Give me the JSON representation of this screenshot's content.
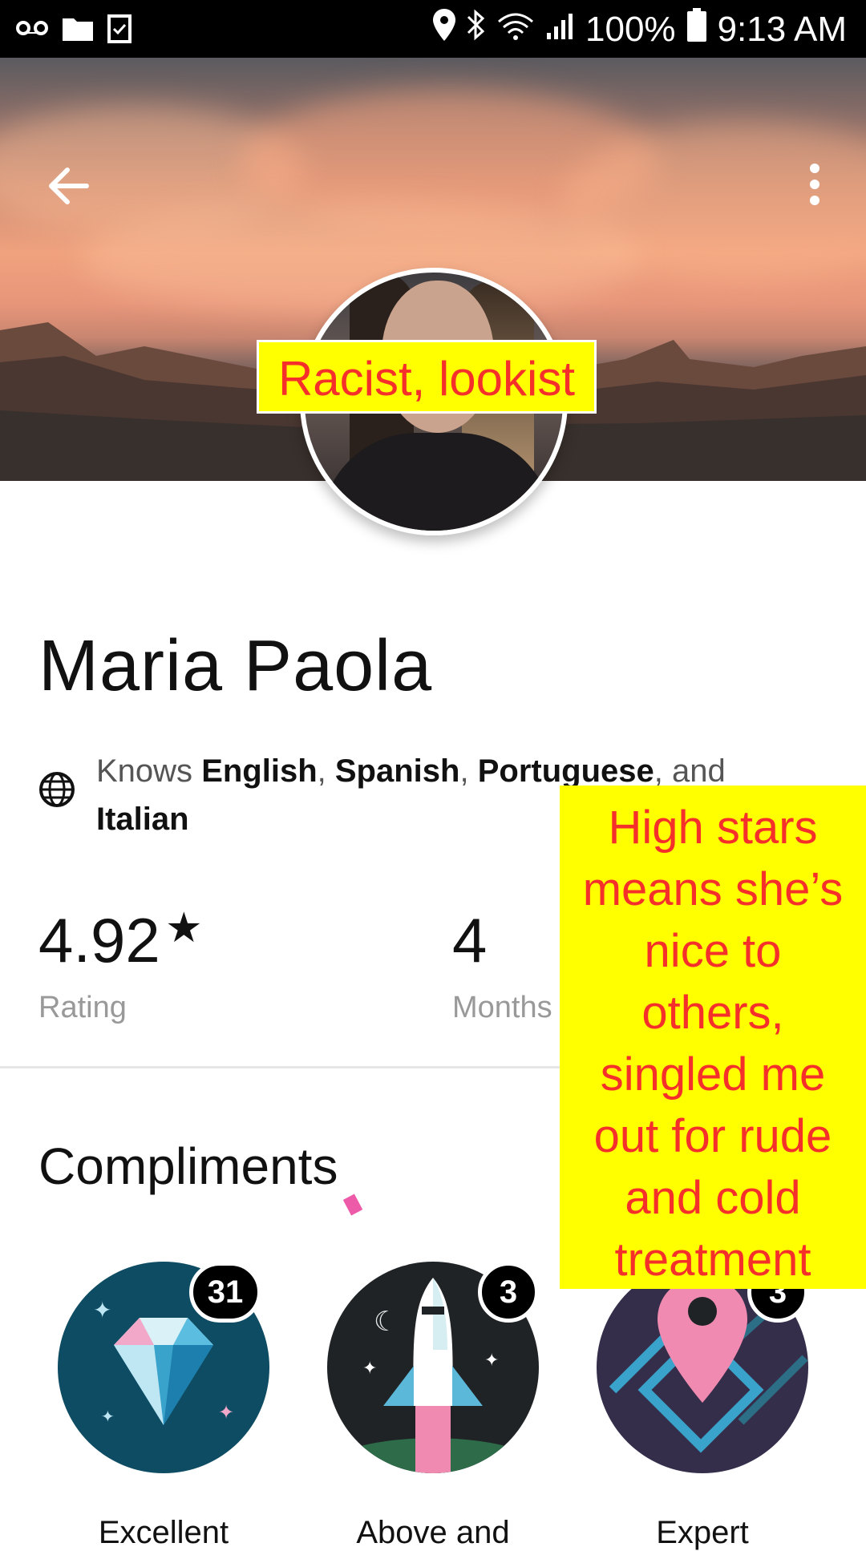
{
  "status_bar": {
    "battery_percent": "100%",
    "time": "9:13 AM",
    "left_icons": [
      "voicemail-icon",
      "folder-icon",
      "task-icon"
    ],
    "right_icons": [
      "location-icon",
      "bluetooth-icon",
      "wifi-icon",
      "signal-icon",
      "battery-icon"
    ]
  },
  "header": {
    "back_icon": "arrow-left-icon",
    "more_icon": "more-vertical-icon"
  },
  "annotations": {
    "top_label": "Racist, lookist",
    "side_lines": [
      "High stars",
      "means she’s",
      "nice to",
      "others,",
      "singled me",
      "out for rude",
      "and cold",
      "treatment"
    ]
  },
  "profile": {
    "name": "Maria Paola",
    "languages_prefix": "Knows",
    "languages": [
      "English",
      "Spanish",
      "Portuguese",
      "Italian"
    ],
    "languages_joiner_and": ", and",
    "rating_value": "4.92",
    "rating_label": "Rating",
    "months_value": "4",
    "months_label": "Months"
  },
  "compliments": {
    "title": "Compliments",
    "badges": [
      {
        "count": "31",
        "label": "Excellent",
        "icon": "diamond-icon",
        "bg": "#0e4c63"
      },
      {
        "count": "3",
        "label": "Above and",
        "icon": "rocket-icon",
        "bg": "#1f2326"
      },
      {
        "count": "3",
        "label": "Expert",
        "icon": "map-pin-route-icon",
        "bg": "#352e4b"
      }
    ]
  },
  "colors": {
    "annotation_bg": "#ffff00",
    "annotation_text": "#f5302a"
  }
}
